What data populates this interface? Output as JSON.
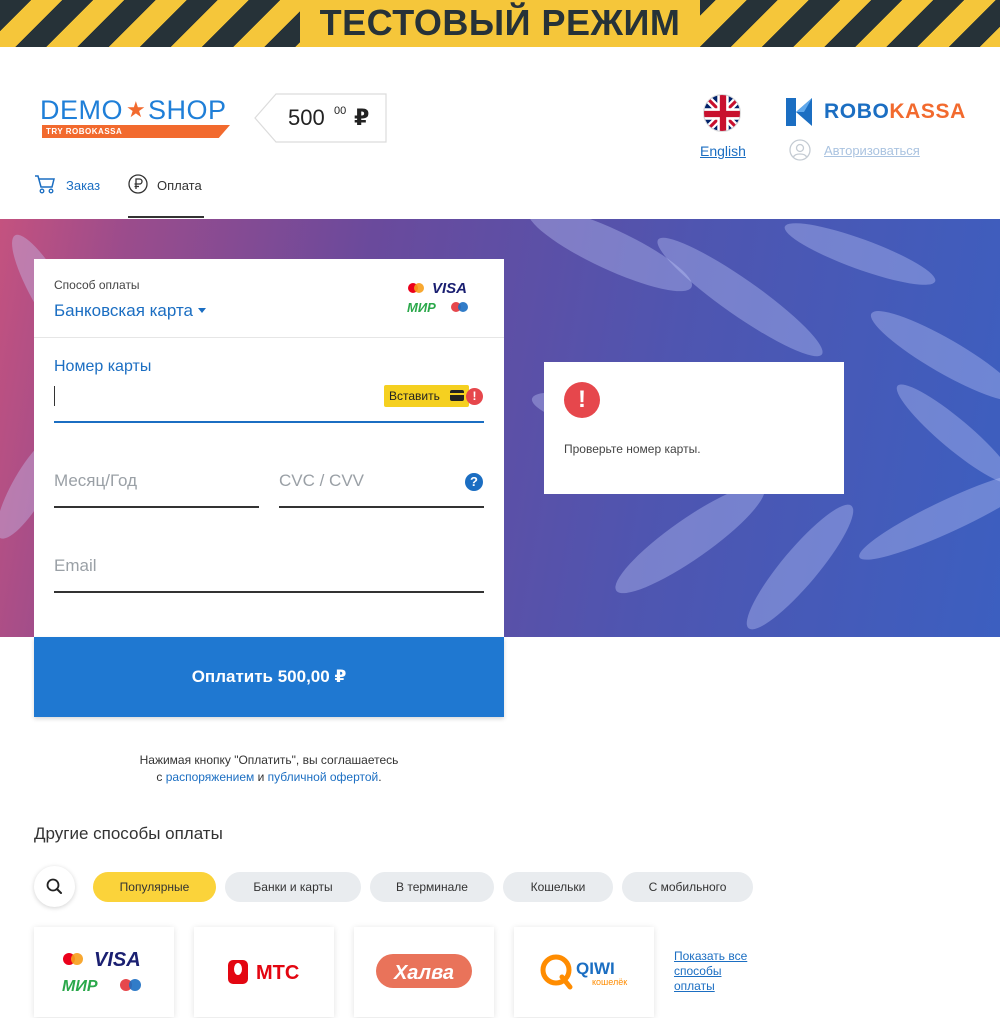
{
  "banner": {
    "text": "ТЕСТОВЫЙ РЕЖИМ"
  },
  "header": {
    "logo": {
      "word1": "DEMO",
      "word2": "SHOP",
      "tagline": "TRY ROBOKASSA"
    },
    "price": {
      "amount": "500",
      "cents": "00",
      "currency": "₽"
    },
    "language": {
      "label": "English"
    },
    "brand": {
      "part1": "ROBO",
      "part2": "KASSA"
    },
    "auth": {
      "label": "Авторизоваться"
    }
  },
  "tabs": [
    {
      "label": "Заказ",
      "icon": "cart-icon"
    },
    {
      "label": "Оплата",
      "icon": "ruble-icon"
    }
  ],
  "payment": {
    "method_label": "Способ оплаты",
    "method_value": "Банковская карта",
    "card_number": {
      "label": "Номер карты",
      "value": ""
    },
    "paste_label": "Вставить",
    "expiry": {
      "placeholder": "Месяц/Год"
    },
    "cvc": {
      "placeholder": "CVC / CVV"
    },
    "email": {
      "placeholder": "Email"
    },
    "pay_button": "Оплатить 500,00 ₽"
  },
  "error": {
    "message": "Проверьте номер карты."
  },
  "terms": {
    "line1": "Нажимая кнопку \"Оплатить\", вы соглашаетесь",
    "prefix": "с ",
    "link1": "распоряжением",
    "middle": " и ",
    "link2": "публичной офертой",
    "suffix": "."
  },
  "other_methods": {
    "title": "Другие способы оплаты",
    "filters": [
      {
        "label": "Популярные",
        "active": true
      },
      {
        "label": "Банки и карты",
        "active": false
      },
      {
        "label": "В терминале",
        "active": false
      },
      {
        "label": "Кошельки",
        "active": false
      },
      {
        "label": "С мобильного",
        "active": false
      }
    ],
    "tiles": [
      {
        "name": "cards-tile",
        "labels": [
          "VISA",
          "МИР"
        ]
      },
      {
        "name": "mts-tile",
        "label": "МТС"
      },
      {
        "name": "halva-tile",
        "label": "Халва"
      },
      {
        "name": "qiwi-tile",
        "label": "QIWI",
        "sub": "кошелёк"
      }
    ],
    "show_all": "Показать все способы оплаты"
  },
  "colors": {
    "accent": "#1b6ec2",
    "pay_button": "#1f78d1",
    "error": "#e6474c",
    "filter_active": "#fbd33a",
    "brand_orange": "#f26a2e"
  }
}
